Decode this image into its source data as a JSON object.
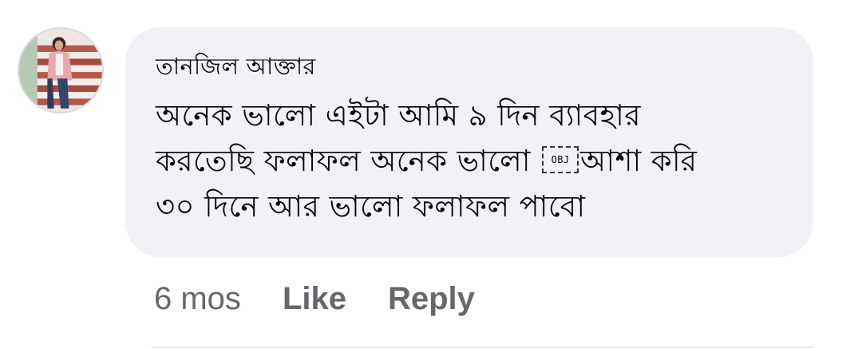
{
  "comment": {
    "author": "তানজিল আক্তার",
    "text_line1": "অনেক ভালো এইটা আমি ৯ দিন ব্যাবহার",
    "text_line2_before": "করতেছি ফলাফল অনেক ভালো ",
    "object_placeholder": "OBJ",
    "text_line2_after": "আশা করি",
    "text_line3": "৩০ দিনে আর ভালো ফলাফল পাবো",
    "timestamp": "6 mos",
    "like_label": "Like",
    "reply_label": "Reply"
  },
  "colors": {
    "bubble_bg": "#f0f2f5",
    "text": "#050505",
    "secondary_text": "#65676b"
  },
  "icons": {
    "avatar": "profile-photo"
  }
}
